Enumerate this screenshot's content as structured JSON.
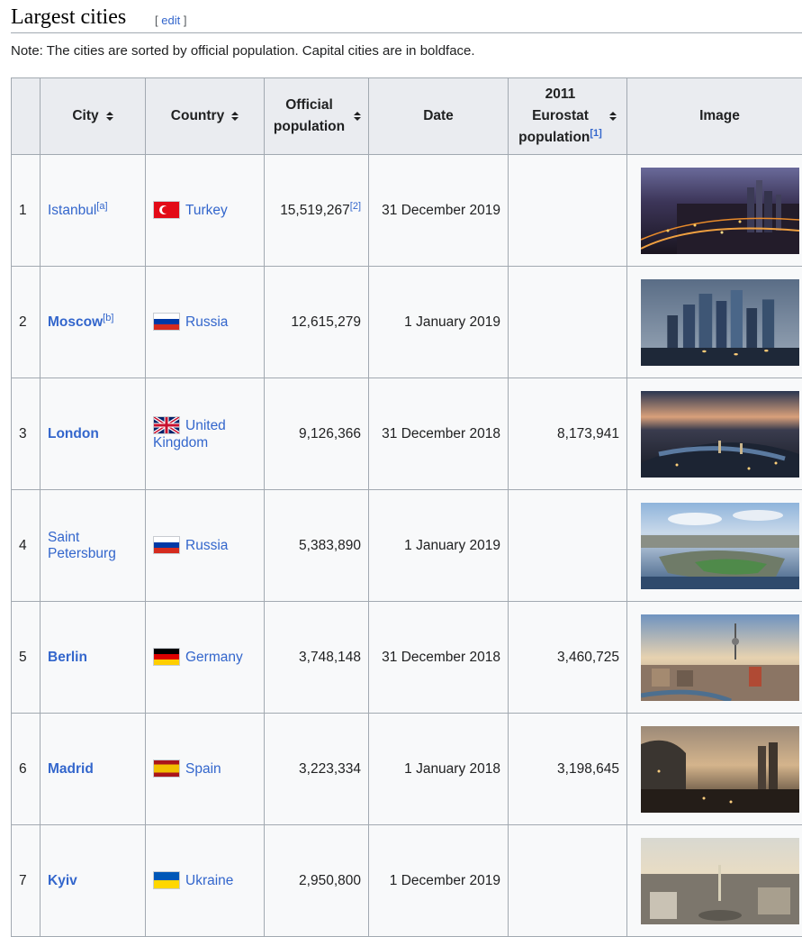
{
  "section": {
    "title": "Largest cities",
    "edit_open": "[ ",
    "edit_label": "edit",
    "edit_close": " ]",
    "note": "Note: The cities are sorted by official population. Capital cities are in boldface."
  },
  "table": {
    "headers": {
      "city": "City",
      "country": "Country",
      "official_population": "Official population",
      "date": "Date",
      "eurostat_line1": "2011",
      "eurostat_line2": "Eurostat",
      "eurostat_line3": "population",
      "eurostat_ref": "[1]",
      "image": "Image"
    },
    "rows": [
      {
        "rank": "1",
        "city": "Istanbul",
        "city_ref": "[a]",
        "capital": false,
        "country": "Turkey",
        "flag": "flag-turkey-icon",
        "population": "15,519,267",
        "population_ref": "[2]",
        "date": "31 December 2019",
        "eurostat": ""
      },
      {
        "rank": "2",
        "city": "Moscow",
        "city_ref": "[b]",
        "capital": true,
        "country": "Russia",
        "flag": "flag-russia-icon",
        "population": "12,615,279",
        "population_ref": "",
        "date": "1 January 2019",
        "eurostat": ""
      },
      {
        "rank": "3",
        "city": "London",
        "city_ref": "",
        "capital": true,
        "country_line1": "United",
        "country_line2": "Kingdom",
        "flag": "flag-uk-icon",
        "population": "9,126,366",
        "population_ref": "",
        "date": "31 December 2018",
        "eurostat": "8,173,941"
      },
      {
        "rank": "4",
        "city_line1": "Saint",
        "city_line2": "Petersburg",
        "city_ref": "",
        "capital": false,
        "country": "Russia",
        "flag": "flag-russia-icon",
        "population": "5,383,890",
        "population_ref": "",
        "date": "1 January 2019",
        "eurostat": ""
      },
      {
        "rank": "5",
        "city": "Berlin",
        "city_ref": "",
        "capital": true,
        "country": "Germany",
        "flag": "flag-germany-icon",
        "population": "3,748,148",
        "population_ref": "",
        "date": "31 December 2018",
        "eurostat": "3,460,725"
      },
      {
        "rank": "6",
        "city": "Madrid",
        "city_ref": "",
        "capital": true,
        "country": "Spain",
        "flag": "flag-spain-icon",
        "population": "3,223,334",
        "population_ref": "",
        "date": "1 January 2018",
        "eurostat": "3,198,645"
      },
      {
        "rank": "7",
        "city": "Kyiv",
        "city_ref": "",
        "capital": true,
        "country": "Ukraine",
        "flag": "flag-ukraine-icon",
        "population": "2,950,800",
        "population_ref": "",
        "date": "1 December 2019",
        "eurostat": ""
      }
    ]
  },
  "colors": {
    "link": "#3366cc",
    "header_bg": "#eaecf0",
    "cell_bg": "#f8f9fa",
    "border": "#a2a9b1"
  }
}
